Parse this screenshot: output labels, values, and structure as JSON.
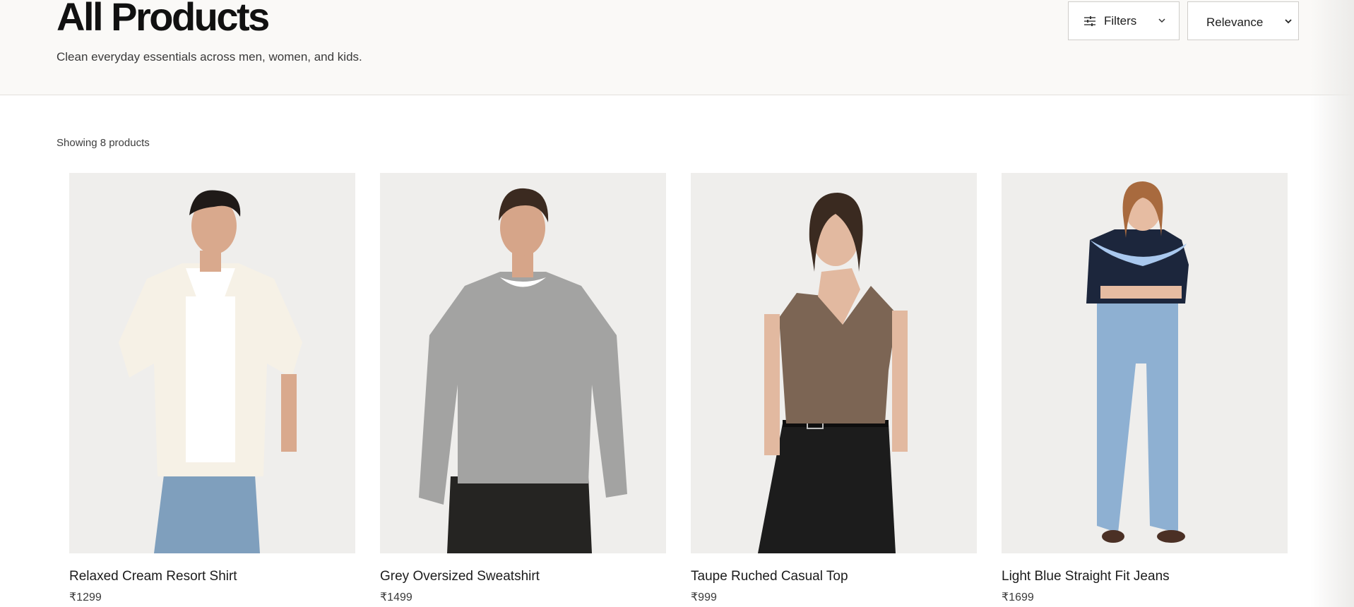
{
  "header": {
    "title": "All Products",
    "subtitle": "Clean everyday essentials across men, women, and kids."
  },
  "toolbar": {
    "filters_label": "Filters",
    "sort_selected": "Relevance"
  },
  "results": {
    "count_text": "Showing 8 products"
  },
  "products": [
    {
      "name": "Relaxed Cream Resort Shirt",
      "price": "₹1299"
    },
    {
      "name": "Grey Oversized Sweatshirt",
      "price": "₹1499"
    },
    {
      "name": "Taupe Ruched Casual Top",
      "price": "₹999"
    },
    {
      "name": "Light Blue Straight Fit Jeans",
      "price": "₹1699"
    }
  ],
  "colors": {
    "header_bg": "#faf9f7",
    "photo_bg": "#efeeec",
    "border": "#cfcdca"
  },
  "icons": [
    "sliders-icon",
    "chevron-down-icon"
  ]
}
